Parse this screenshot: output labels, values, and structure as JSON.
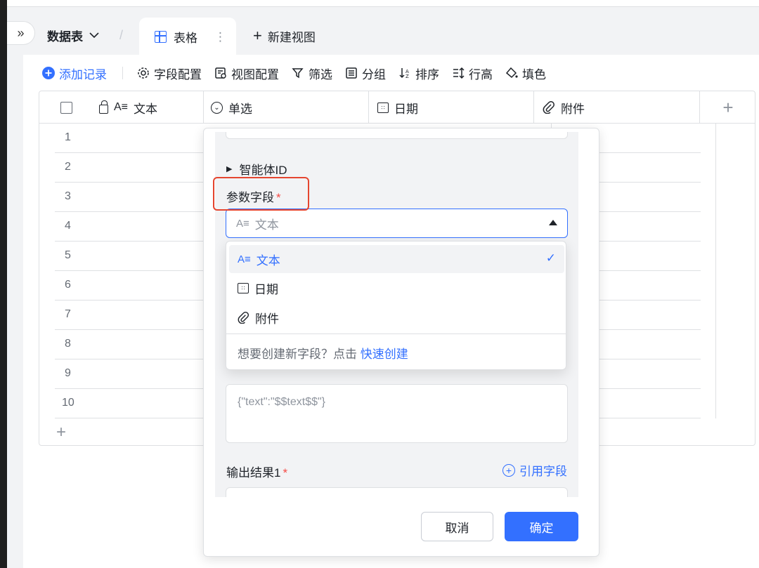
{
  "window": {
    "collapse_glyph": "»"
  },
  "tabs": {
    "datasheet": "数据表",
    "active_tab": "表格",
    "new_view": "新建视图"
  },
  "toolbar": {
    "add_record": "添加记录",
    "field_config": "字段配置",
    "view_config": "视图配置",
    "filter": "筛选",
    "group": "分组",
    "sort": "排序",
    "row_height": "行高",
    "fill": "填色"
  },
  "table": {
    "columns": [
      {
        "label": "文本",
        "icon": "text-field-icon"
      },
      {
        "label": "单选",
        "icon": "single-select-icon"
      },
      {
        "label": "日期",
        "icon": "calendar-icon"
      },
      {
        "label": "附件",
        "icon": "attachment-icon"
      }
    ],
    "rows": [
      "1",
      "2",
      "3",
      "4",
      "5",
      "6",
      "7",
      "8",
      "9",
      "10"
    ]
  },
  "panel": {
    "agent_id_label": "智能体ID",
    "param_field_label": "参数字段",
    "required_mark": "*",
    "select_value": "文本",
    "dropdown": {
      "options": [
        {
          "label": "文本",
          "icon": "text-field-icon",
          "selected": true
        },
        {
          "label": "日期",
          "icon": "calendar-icon",
          "selected": false
        },
        {
          "label": "附件",
          "icon": "attachment-icon",
          "selected": false
        }
      ],
      "footer_text": "想要创建新字段？点击",
      "footer_link": "快速创建"
    },
    "textarea_placeholder": "{\"text\":\"$$text$$\"}",
    "output_label": "输出结果1",
    "quote_field": "引用字段",
    "cancel": "取消",
    "confirm": "确定"
  },
  "colors": {
    "accent": "#3370ff",
    "required": "#f54a45",
    "highlight_box": "#e5452f"
  }
}
